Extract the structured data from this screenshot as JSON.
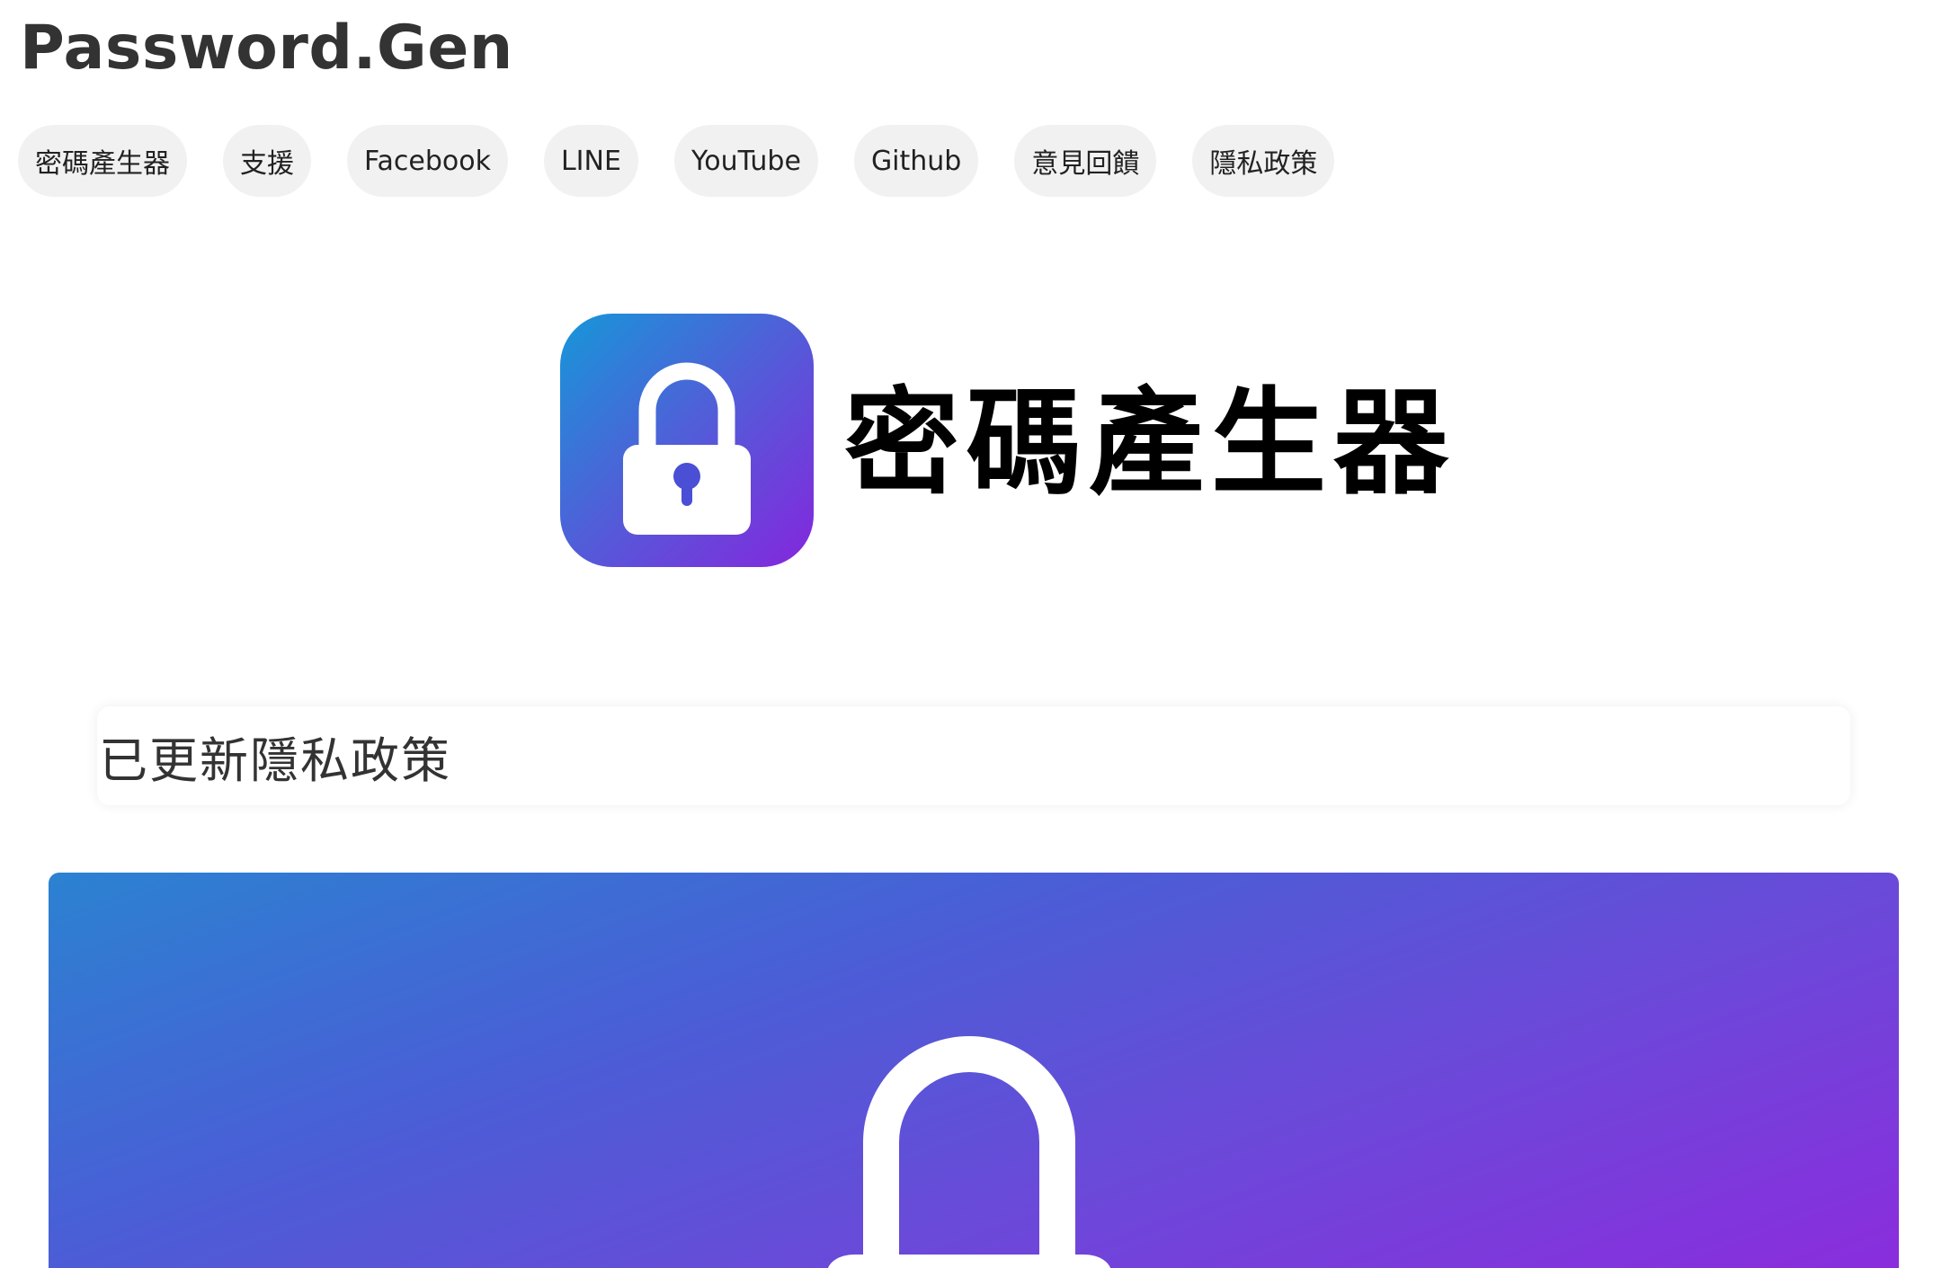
{
  "header": {
    "site_title": "Password.Gen"
  },
  "nav": {
    "items": [
      {
        "label": "密碼產生器"
      },
      {
        "label": "支援"
      },
      {
        "label": "Facebook"
      },
      {
        "label": "LINE"
      },
      {
        "label": "YouTube"
      },
      {
        "label": "Github"
      },
      {
        "label": "意見回饋"
      },
      {
        "label": "隱私政策"
      }
    ]
  },
  "hero": {
    "icon": "lock-icon",
    "title": "密碼產生器"
  },
  "notice": {
    "text": "已更新隱私政策"
  },
  "banner": {
    "icon": "lock-icon"
  },
  "colors": {
    "gradient_start": "#1697d8",
    "gradient_mid": "#4d62d8",
    "gradient_end": "#8526dd",
    "pill_bg": "#f1f1f1",
    "title_text": "#333333"
  }
}
